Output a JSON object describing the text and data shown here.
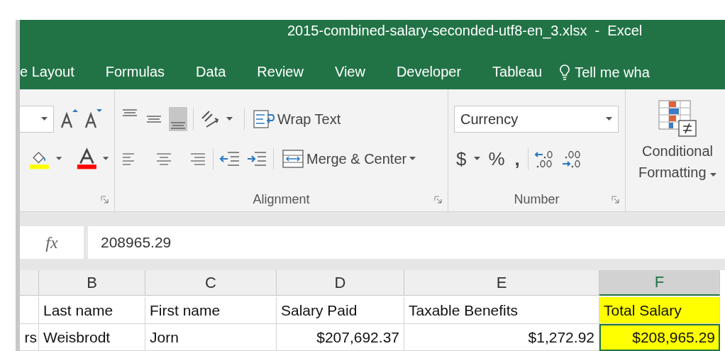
{
  "window": {
    "title": "2015-combined-salary-seconded-utf8-en_3.xlsx  -  Excel"
  },
  "tabs": [
    {
      "label": "e Layout",
      "selected": false
    },
    {
      "label": "Formulas",
      "selected": false
    },
    {
      "label": "Data",
      "selected": false
    },
    {
      "label": "Review",
      "selected": false
    },
    {
      "label": "View",
      "selected": false
    },
    {
      "label": "Developer",
      "selected": false
    },
    {
      "label": "Tableau",
      "selected": false
    }
  ],
  "tell_me": "Tell me wha",
  "ribbon": {
    "alignment": {
      "label": "Alignment",
      "vertical": [
        {
          "kind": "top",
          "selected": false
        },
        {
          "kind": "middle",
          "selected": false
        },
        {
          "kind": "bottom",
          "selected": true
        }
      ],
      "wrap_text": "Wrap Text",
      "merge": "Merge & Center"
    },
    "number": {
      "label": "Number",
      "format": "Currency",
      "currency": "$",
      "percent": "%",
      "comma": ","
    },
    "styles": {
      "conditional": "Conditional Formatting"
    }
  },
  "formula_bar": {
    "function_label": "fx",
    "value": "208965.29"
  },
  "columns": [
    {
      "label": "B",
      "selected": false
    },
    {
      "label": "C",
      "selected": false
    },
    {
      "label": "D",
      "selected": false
    },
    {
      "label": "E",
      "selected": false
    },
    {
      "label": "F",
      "selected": true
    }
  ],
  "rows": [
    {
      "selected": false,
      "cells": [
        {
          "text": "Last name",
          "numeric": false
        },
        {
          "text": "First name",
          "numeric": false
        },
        {
          "text": "Salary Paid",
          "numeric": false
        },
        {
          "text": "Taxable Benefits",
          "numeric": false
        },
        {
          "text": "Total Salary",
          "numeric": false
        }
      ]
    },
    {
      "selected": true,
      "column_a": "rs",
      "cells": [
        {
          "text": "Weisbrodt",
          "numeric": false
        },
        {
          "text": "Jorn",
          "numeric": false
        },
        {
          "text": "$207,692.37",
          "numeric": true
        },
        {
          "text": "$1,272.92",
          "numeric": true
        },
        {
          "text": "$208,965.29",
          "numeric": true
        }
      ]
    }
  ]
}
